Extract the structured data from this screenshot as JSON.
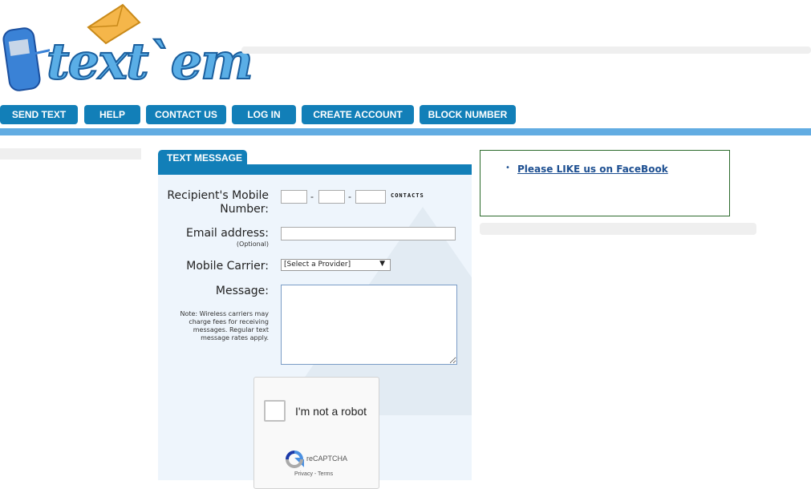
{
  "logo": {
    "text": "text`em"
  },
  "nav": [
    {
      "label": "SEND TEXT"
    },
    {
      "label": "HELP"
    },
    {
      "label": "CONTACT US"
    },
    {
      "label": "LOG IN"
    },
    {
      "label": "CREATE ACCOUNT"
    },
    {
      "label": "BLOCK NUMBER"
    }
  ],
  "form": {
    "tab": "TEXT MESSAGE",
    "recipient_label": "Recipient's Mobile Number:",
    "dash": "-",
    "contacts": "CONTACTS",
    "email_label": "Email address:",
    "email_optional": "(Optional)",
    "carrier_label": "Mobile Carrier:",
    "carrier_value": "[Select a Provider]",
    "message_label": "Message:",
    "note": "Note: Wireless carriers may charge fees for receiving messages. Regular text message rates apply."
  },
  "captcha": {
    "label": "I'm not a robot",
    "brand": "reCAPTCHA",
    "links": "Privacy - Terms"
  },
  "facebook": {
    "link": "Please LIKE us on FaceBook"
  },
  "colors": {
    "nav": "#127fb8",
    "bar": "#62ace2",
    "panel": "#eef5fc"
  }
}
